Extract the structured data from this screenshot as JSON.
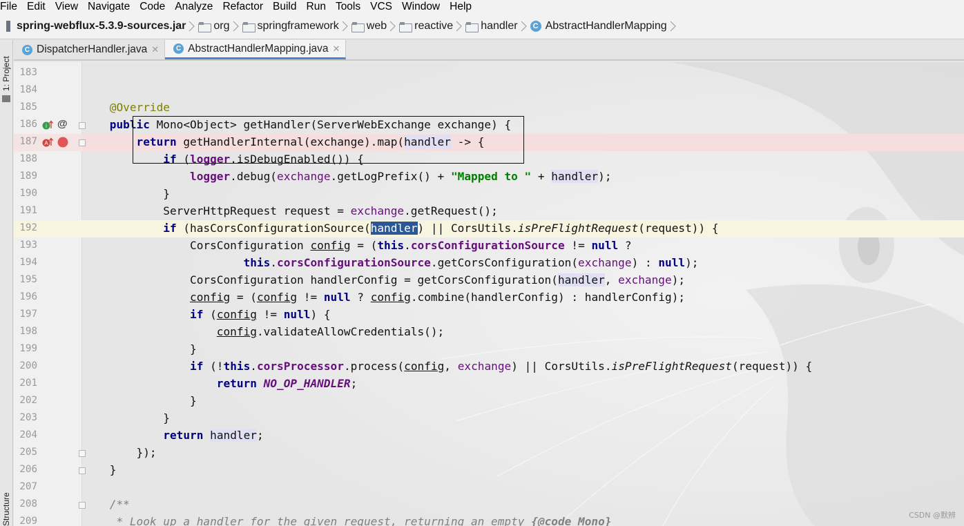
{
  "menubar": {
    "items": [
      "File",
      "Edit",
      "View",
      "Navigate",
      "Code",
      "Analyze",
      "Refactor",
      "Build",
      "Run",
      "Tools",
      "VCS",
      "Window",
      "Help"
    ]
  },
  "breadcrumb": {
    "jar": "spring-webflux-5.3.9-sources.jar",
    "packages": [
      "org",
      "springframework",
      "web",
      "reactive",
      "handler"
    ],
    "class_name": "AbstractHandlerMapping",
    "class_icon": "C"
  },
  "sidebar": {
    "project_label": "1: Project",
    "structure_label": "Structure"
  },
  "tabs": [
    {
      "label": "DispatcherHandler.java",
      "icon": "C",
      "active": false
    },
    {
      "label": "AbstractHandlerMapping.java",
      "icon": "C",
      "active": true
    }
  ],
  "editor": {
    "line_numbers": [
      "183",
      "184",
      "185",
      "186",
      "187",
      "188",
      "189",
      "190",
      "191",
      "192",
      "193",
      "194",
      "195",
      "196",
      "197",
      "198",
      "199",
      "200",
      "201",
      "202",
      "203",
      "204",
      "205",
      "206",
      "207",
      "208",
      "209"
    ],
    "code": {
      "l185": "@Override",
      "l186_kw": "public",
      "l186_rest": " Mono<Object> getHandler(ServerWebExchange ",
      "l186_param": "exchange",
      "l186_end": ") {",
      "l187_kw": "return",
      "l187_a": " getHandlerInternal(",
      "l187_b": "exchange",
      "l187_c": ").map(",
      "l187_d": "handler",
      "l187_e": " -> {",
      "l188_kw": "if",
      "l188_a": " (",
      "l188_b": "logger",
      "l188_c": ".isDebugEnabled()) {",
      "l189_a": "logger",
      "l189_b": ".debug(",
      "l189_c": "exchange",
      "l189_d": ".getLogPrefix() + ",
      "l189_e": "\"Mapped to \"",
      "l189_f": " + ",
      "l189_g": "handler",
      "l189_h": ");",
      "l190": "}",
      "l191_a": "ServerHttpRequest request = ",
      "l191_b": "exchange",
      "l191_c": ".getRequest();",
      "l192_kw": "if",
      "l192_a": " (hasCorsConfigurationSource(",
      "l192_b": "handler",
      "l192_c": ") || CorsUtils.",
      "l192_d": "isPreFlightRequest",
      "l192_e": "(request)) {",
      "l193_a": "CorsConfiguration ",
      "l193_b": "config",
      "l193_c": " = (",
      "l193_kw": "this",
      "l193_d": ".",
      "l193_e": "corsConfigurationSource",
      "l193_f": " != ",
      "l193_kw2": "null",
      "l193_g": " ?",
      "l194_kw": "this",
      "l194_a": ".",
      "l194_b": "corsConfigurationSource",
      "l194_c": ".getCorsConfiguration(",
      "l194_d": "exchange",
      "l194_e": ") : ",
      "l194_kw2": "null",
      "l194_f": ");",
      "l195_a": "CorsConfiguration handlerConfig = getCorsConfiguration(",
      "l195_b": "handler",
      "l195_c": ", ",
      "l195_d": "exchange",
      "l195_e": ");",
      "l196_a": "config",
      "l196_b": " = (",
      "l196_c": "config",
      "l196_d": " != ",
      "l196_kw": "null",
      "l196_e": " ? ",
      "l196_f": "config",
      "l196_g": ".combine(handlerConfig) : handlerConfig);",
      "l197_kw": "if",
      "l197_a": " (",
      "l197_b": "config",
      "l197_c": " != ",
      "l197_kw2": "null",
      "l197_d": ") {",
      "l198_a": "config",
      "l198_b": ".validateAllowCredentials();",
      "l199": "}",
      "l200_kw": "if",
      "l200_a": " (!",
      "l200_kw2": "this",
      "l200_b": ".",
      "l200_c": "corsProcessor",
      "l200_d": ".process(",
      "l200_e": "config",
      "l200_f": ", ",
      "l200_g": "exchange",
      "l200_h": ") || CorsUtils.",
      "l200_i": "isPreFlightRequest",
      "l200_j": "(request)) {",
      "l201_kw": "return",
      "l201_a": " ",
      "l201_b": "NO_OP_HANDLER",
      "l201_c": ";",
      "l202": "}",
      "l203": "}",
      "l204_kw": "return",
      "l204_a": " ",
      "l204_b": "handler",
      "l204_c": ";",
      "l205": "});",
      "l206": "}",
      "l208": "/**",
      "l209_a": " * Look up a handler for the given request, returning an empty ",
      "l209_b": "{@code Mono}"
    }
  },
  "gutter_icons": {
    "l186_impl": "implements-icon",
    "l186_at": "@",
    "l187_override": "override-icon",
    "l187_breakpoint": "breakpoint-icon"
  },
  "watermark": "CSDN @默辨",
  "colors": {
    "keyword": "#000080",
    "string": "#008000",
    "field": "#660e7a",
    "annotation": "#808000",
    "selection": "#2b5797",
    "breakpoint": "#e05555"
  }
}
